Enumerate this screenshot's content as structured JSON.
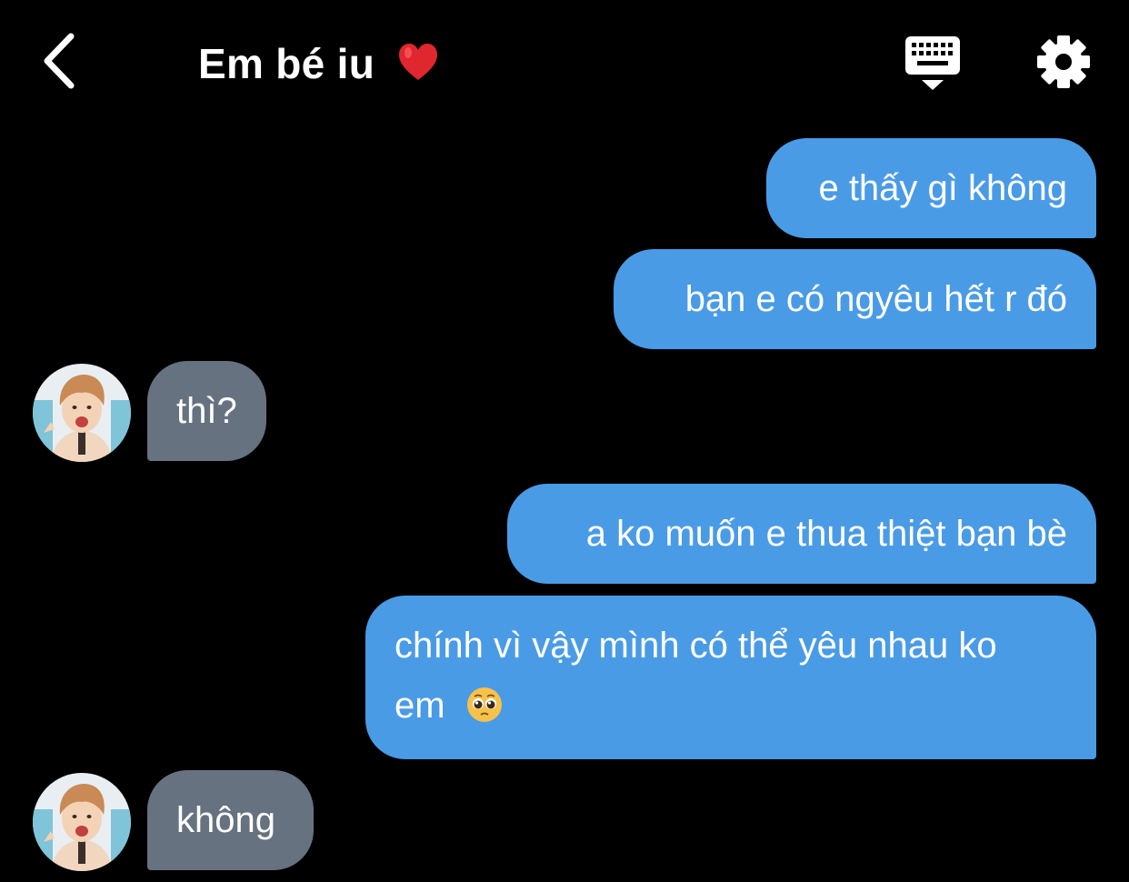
{
  "header": {
    "title": "Em bé iu",
    "back_icon": "chevron-left-icon",
    "keyboard_icon": "keyboard-hide-icon",
    "settings_icon": "gear-icon"
  },
  "colors": {
    "background": "#000000",
    "outgoing_bubble": "#4a9be6",
    "incoming_bubble": "#667280",
    "text": "#ffffff",
    "heart": "#e0262f"
  },
  "messages": [
    {
      "sender": "me",
      "text": "e thấy gì không"
    },
    {
      "sender": "me",
      "text": "bạn e có ngyêu hết r đó"
    },
    {
      "sender": "contact",
      "text": "thì?"
    },
    {
      "sender": "me",
      "text": "a ko muốn e thua thiệt bạn bè"
    },
    {
      "sender": "me",
      "text_line1": "chính vì vậy mình có thể yêu nhau ko",
      "text_line2": "em",
      "emoji": "pleading-face-icon"
    },
    {
      "sender": "contact",
      "text": "không"
    }
  ]
}
